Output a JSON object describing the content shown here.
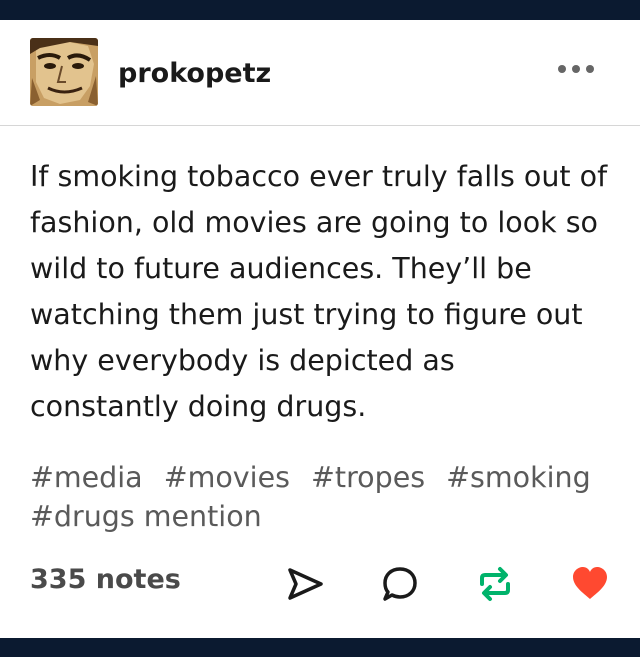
{
  "post": {
    "username": "prokopetz",
    "body": "If smoking tobacco ever truly falls out of\nfashion, old movies are going to look so\nwild to future audiences. They’ll be\nwatching them just trying to figure out\nwhy everybody is depicted as\nconstantly doing drugs.",
    "tags": [
      "#media",
      "#movies",
      "#tropes",
      "#smoking",
      "#drugs mention"
    ],
    "notes": "335 notes"
  },
  "icons": {
    "more": "more-dots-icon",
    "share": "send-arrow-icon",
    "reply": "speech-bubble-icon",
    "reblog": "reblog-arrows-icon",
    "like": "heart-icon"
  },
  "colors": {
    "bar": "#0b1a30",
    "reblog": "#00b36b",
    "like": "#ff4930",
    "icon": "#1a1a1a",
    "tag": "#5a5a5a"
  }
}
